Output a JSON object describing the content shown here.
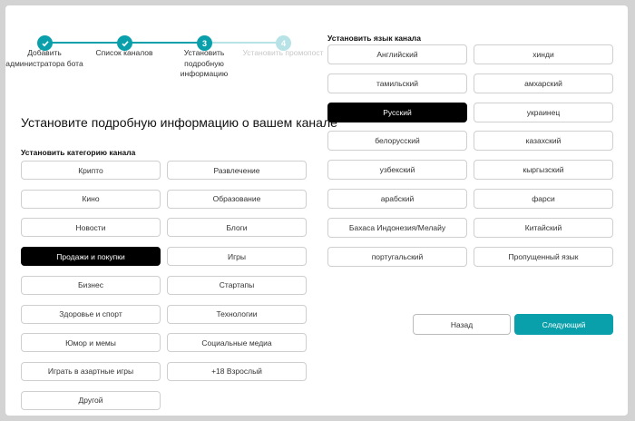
{
  "stepper": {
    "steps": [
      {
        "number": "1",
        "label": "Добавить администратора бота",
        "state": "done"
      },
      {
        "number": "2",
        "label": "Список каналов",
        "state": "done"
      },
      {
        "number": "3",
        "label": "Установить подробную информацию",
        "state": "active"
      },
      {
        "number": "4",
        "label": "Установить промопост",
        "state": "pending"
      }
    ]
  },
  "title": "Установите подробную информацию о вашем канале",
  "category": {
    "label": "Установить категорию канала",
    "selected": "Продажи и покупки",
    "options": [
      "Крипто",
      "Развлечение",
      "Кино",
      "Образование",
      "Новости",
      "Блоги",
      "Продажи и покупки",
      "Игры",
      "Бизнес",
      "Стартапы",
      "Здоровье и спорт",
      "Технологии",
      "Юмор и мемы",
      "Социальные медиа",
      "Играть в азартные игры",
      "+18 Взрослый",
      "Другой"
    ]
  },
  "language": {
    "label": "Установить язык канала",
    "selected": "Русский",
    "options": [
      "Английский",
      "хинди",
      "тамильский",
      "амхарский",
      "Русский",
      "украинец",
      "белорусский",
      "казахский",
      "узбекский",
      "кыргызский",
      "арабский",
      "фарси",
      "Бахаса Индонезия/Мелайу",
      "Китайский",
      "португальский",
      "Пропущенный язык"
    ]
  },
  "nav": {
    "back": "Назад",
    "next": "Следующий"
  },
  "colors": {
    "accent": "#0aa0ab",
    "pending": "#b7e3e7"
  }
}
